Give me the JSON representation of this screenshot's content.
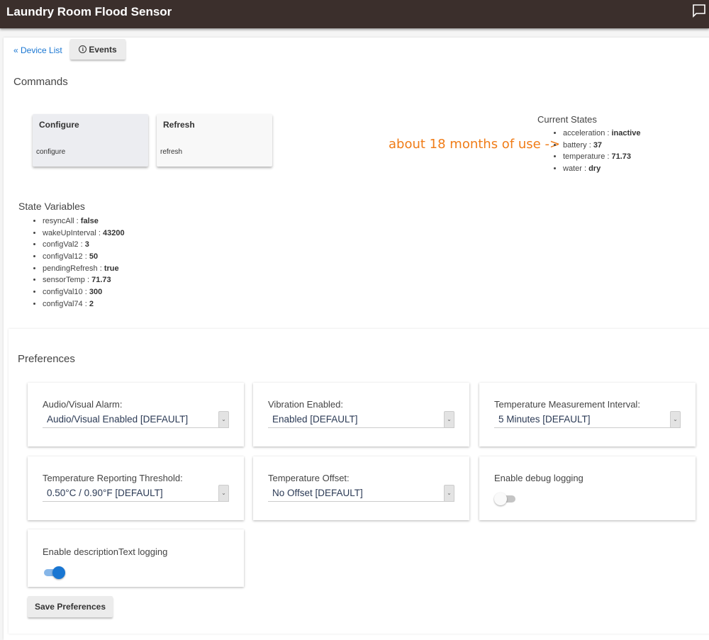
{
  "header": {
    "title": "Laundry Room Flood Sensor",
    "chat_icon": "chat-bubble-icon"
  },
  "nav": {
    "device_list_label": "« Device List",
    "events_label": "Events",
    "events_icon": "info-icon"
  },
  "commands": {
    "title": "Commands",
    "items": [
      {
        "name": "Configure",
        "method": "configure"
      },
      {
        "name": "Refresh",
        "method": "refresh"
      }
    ]
  },
  "current_states": {
    "title": "Current States",
    "items": [
      {
        "key": "acceleration",
        "value": "inactive"
      },
      {
        "key": "battery",
        "value": "37"
      },
      {
        "key": "temperature",
        "value": "71.73"
      },
      {
        "key": "water",
        "value": "dry"
      }
    ]
  },
  "annotation": {
    "text": "about 18 months of use ->",
    "color": "#f07c17"
  },
  "state_variables": {
    "title": "State Variables",
    "items": [
      {
        "key": "resyncAll",
        "value": "false"
      },
      {
        "key": "wakeUpInterval",
        "value": "43200"
      },
      {
        "key": "configVal2",
        "value": "3"
      },
      {
        "key": "configVal12",
        "value": "50"
      },
      {
        "key": "pendingRefresh",
        "value": "true"
      },
      {
        "key": "sensorTemp",
        "value": "71.73"
      },
      {
        "key": "configVal10",
        "value": "300"
      },
      {
        "key": "configVal74",
        "value": "2"
      }
    ]
  },
  "preferences": {
    "title": "Preferences",
    "selects": [
      {
        "label": "Audio/Visual Alarm:",
        "value": "Audio/Visual Enabled [DEFAULT]"
      },
      {
        "label": "Vibration Enabled:",
        "value": "Enabled [DEFAULT]"
      },
      {
        "label": "Temperature Measurement Interval:",
        "value": "5 Minutes [DEFAULT]"
      },
      {
        "label": "Temperature Reporting Threshold:",
        "value": "0.50°C / 0.90°F [DEFAULT]"
      },
      {
        "label": "Temperature Offset:",
        "value": "No Offset [DEFAULT]"
      }
    ],
    "toggles": [
      {
        "label": "Enable debug logging",
        "checked": false
      },
      {
        "label": "Enable descriptionText logging",
        "checked": true
      }
    ],
    "save_label": "Save Preferences"
  },
  "colors": {
    "header_bg": "#3b2f2c",
    "link": "#1976d2",
    "toggle_on": "#1976d2"
  }
}
